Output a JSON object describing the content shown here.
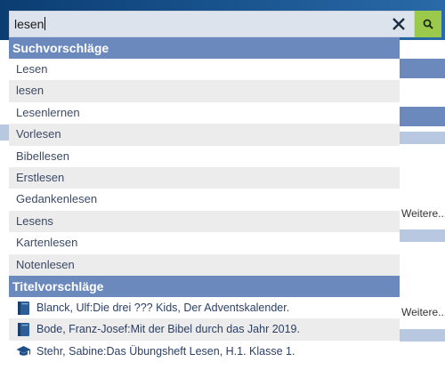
{
  "search": {
    "value": "lesen",
    "clear_icon": "close-icon",
    "submit_icon": "search-icon"
  },
  "background": {
    "more_labels": [
      "Weitere...",
      "Weitere..."
    ]
  },
  "suggestions": {
    "header": "Suchvorschläge",
    "items": [
      "Lesen",
      "lesen",
      "Lesenlernen",
      "Vorlesen",
      "Bibellesen",
      "Erstlesen",
      "Gedankenlesen",
      "Lesens",
      "Kartenlesen",
      "Notenlesen"
    ]
  },
  "titles": {
    "header": "Titelvorschläge",
    "items": [
      {
        "text": "Blanck, Ulf:Die drei ??? Kids, Der Adventskalender.",
        "icon": "book-icon"
      },
      {
        "text": "Bode, Franz-Josef:Mit der Bibel durch das Jahr 2019.",
        "icon": "book-icon"
      },
      {
        "text": "Stehr, Sabine:Das Übungsheft Lesen, H.1. Klasse 1.",
        "icon": "mortarboard-icon"
      }
    ]
  },
  "colors": {
    "header_bar": "#0b3d72",
    "section_header": "#6b89bd",
    "search_button": "#9ac94b",
    "alt_row": "#ececec"
  }
}
